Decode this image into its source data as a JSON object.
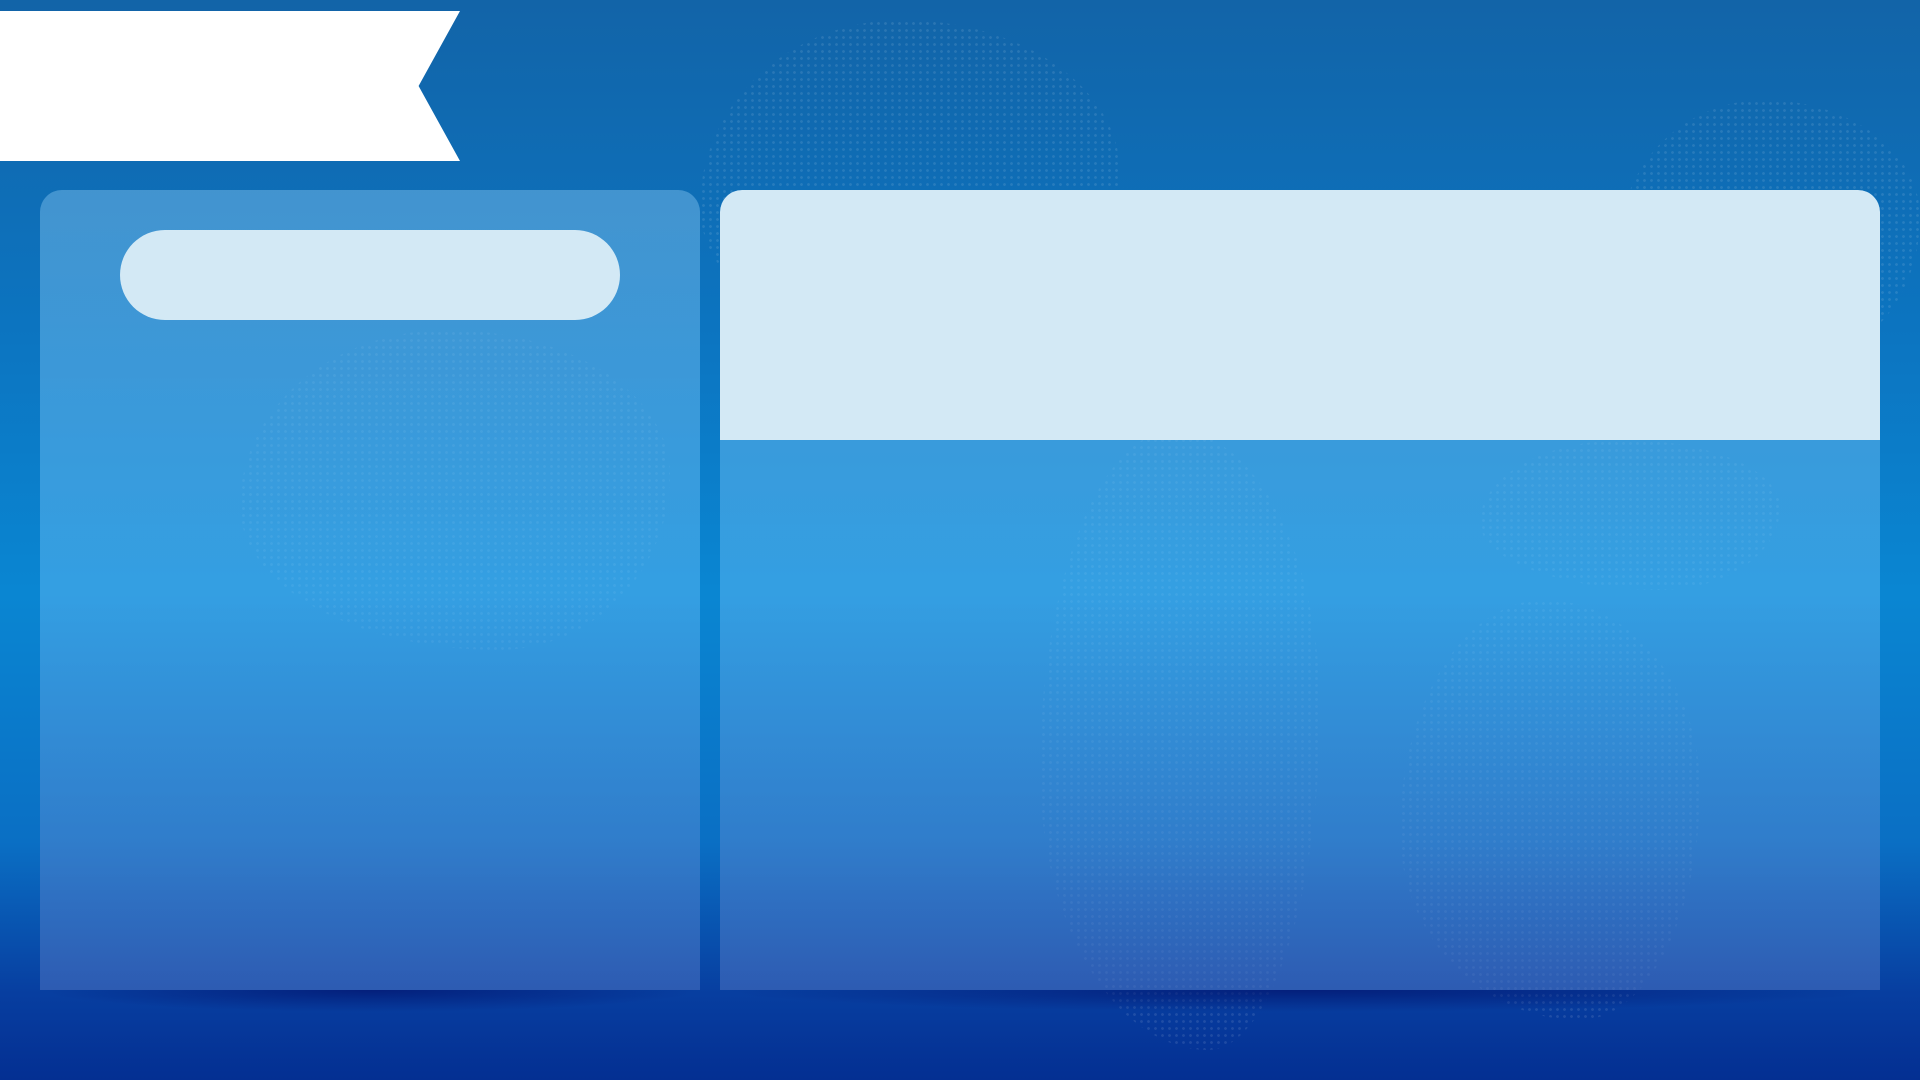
{
  "ribbon": {
    "title": ""
  },
  "left_panel": {
    "pill_label": "",
    "body_text": ""
  },
  "right_panel": {
    "header_text": "",
    "body_text": ""
  },
  "colors": {
    "background_top": "#1264a8",
    "background_mid": "#0a86d2",
    "background_bottom": "#042f92",
    "ribbon": "#ffffff",
    "light_accent": "#d3e9f5"
  }
}
